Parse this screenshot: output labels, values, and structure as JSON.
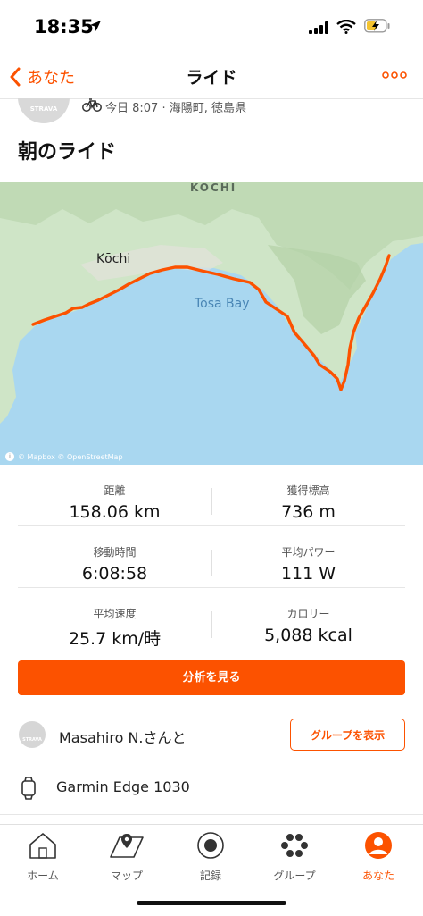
{
  "status_bar": {
    "time": "18:35"
  },
  "nav": {
    "back_label": "あなた",
    "title": "ライド"
  },
  "activity": {
    "avatar_text": "STRAVA",
    "meta": "今日 8:07 · 海陽町, 徳島県",
    "title": "朝のライド"
  },
  "map": {
    "labels": {
      "region": "KOCHI",
      "city": "Kōchi",
      "bay": "Tosa Bay"
    },
    "attribution": "© Mapbox © OpenStreetMap",
    "route_color": "#fc5200"
  },
  "stats": [
    {
      "label": "距離",
      "value": "158.06 km"
    },
    {
      "label": "獲得標高",
      "value": "736 m"
    },
    {
      "label": "移動時間",
      "value": "6:08:58"
    },
    {
      "label": "平均パワー",
      "value": "111 W"
    },
    {
      "label": "平均速度",
      "value": "25.7 km/時"
    },
    {
      "label": "カロリー",
      "value": "5,088 kcal"
    }
  ],
  "actions": {
    "analyze_label": "分析を見る",
    "show_group_label": "グループを表示"
  },
  "group": {
    "avatar_text": "STRAVA",
    "companion_text": "Masahiro N.さんと"
  },
  "device": {
    "name": "Garmin Edge 1030"
  },
  "tabs": [
    {
      "label": "ホーム",
      "icon": "home-icon"
    },
    {
      "label": "マップ",
      "icon": "map-icon"
    },
    {
      "label": "記録",
      "icon": "record-icon"
    },
    {
      "label": "グループ",
      "icon": "group-icon"
    },
    {
      "label": "あなた",
      "icon": "profile-icon",
      "active": true
    }
  ],
  "colors": {
    "accent": "#fc5200",
    "water": "#a9d7f0",
    "land": "#cfe5c7"
  }
}
